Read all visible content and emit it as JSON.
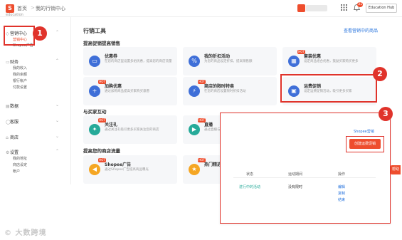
{
  "header": {
    "logo_glyph": "S",
    "breadcrumb_home": "首页",
    "breadcrumb_sep": ">",
    "breadcrumb_current": "我的行销中心",
    "shop_sub": "education",
    "notification_count": "31",
    "shop_button": "Education Hub",
    "icons": [
      "grid-icon",
      "bell-icon"
    ]
  },
  "sidebar": {
    "sections": [
      {
        "label": "营销中心",
        "sub": [
          "营销中心",
          "Shopee广告"
        ]
      },
      {
        "label": "财务",
        "sub": [
          "我的收入",
          "我的余额",
          "银行帐户",
          "付款设置"
        ]
      },
      {
        "label": "数据"
      },
      {
        "label": "客服"
      },
      {
        "label": "商店"
      },
      {
        "label": "设置",
        "sub": [
          "我的地址",
          "商店设定",
          "帐户"
        ]
      }
    ]
  },
  "main": {
    "title": "行销工具",
    "right_link": "查看营销中的商品",
    "section1": "提高促销提高销售",
    "section2": "与买家互动",
    "section3": "提高您的商店流量",
    "cards_row1": [
      {
        "title": "优惠券",
        "desc": "在您的商店里设置多组优惠，提高您的商店流量",
        "hot": false
      },
      {
        "title": "我的折扣活动",
        "desc": "为您的商品设定折扣，提高销售额",
        "hot": false
      },
      {
        "title": "套装优惠",
        "desc": "设定商品组合优惠，鼓励买家购买更多",
        "hot": true
      }
    ],
    "cards_row2": [
      {
        "title": "加购优惠",
        "desc": "通过加购商品提高买家购买意愿",
        "hot": true
      },
      {
        "title": "商店的限时特卖",
        "desc": "在您的商店设置限时折扣活动",
        "hot": true
      },
      {
        "title": "运费促销",
        "desc": "设定运费促销活动，吸引更多买家",
        "hot": false
      }
    ],
    "cards_row3": [
      {
        "title": "关注礼",
        "desc": "通过关注礼吸引更多买家关注您的商店",
        "hot": true
      },
      {
        "title": "直播",
        "desc": "通过直播与买家互动",
        "hot": true
      }
    ],
    "cards_row4": [
      {
        "title": "Shopee广告",
        "desc": "通过Shopee广告提高商品曝光",
        "hot": true
      },
      {
        "title": "热门精选",
        "desc": "",
        "hot": true
      }
    ]
  },
  "markers": [
    "1",
    "2",
    "3"
  ],
  "panel": {
    "link": "Shopee营销",
    "create_button": "创建运费促销",
    "columns": [
      "状态",
      "运动期间",
      "操作"
    ],
    "row": {
      "status": "进行中的活动",
      "period": "没有限时",
      "actions": [
        "编辑",
        "复制",
        "结束"
      ]
    },
    "edge_tag": "帮助"
  },
  "watermark": "© 大数跨境"
}
